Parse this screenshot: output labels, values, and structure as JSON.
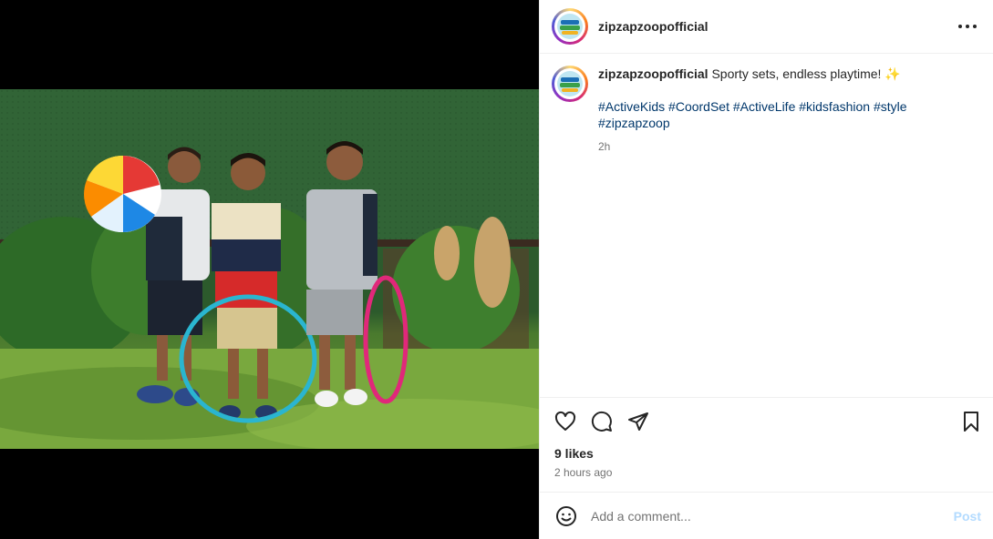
{
  "post": {
    "username": "zipzapzoopofficial",
    "caption": "Sporty sets, endless playtime! ✨",
    "hashtags": [
      "#ActiveKids",
      "#CoordSet",
      "#ActiveLife",
      "#kidsfashion",
      "#style",
      "#zipzapzoop"
    ],
    "caption_time": "2h",
    "likes": "9 likes",
    "posted_ago": "2 hours ago"
  },
  "comment_box": {
    "placeholder": "Add a comment...",
    "post_label": "Post"
  },
  "icons": {
    "more": "more-options-icon",
    "like": "heart-icon",
    "comment": "comment-bubble-icon",
    "share": "paper-plane-icon",
    "save": "bookmark-icon",
    "emoji": "emoji-smiley-icon"
  },
  "colors": {
    "hashtag": "#00376b",
    "post_button_disabled": "#b3dbff",
    "muted_text": "#737373"
  }
}
